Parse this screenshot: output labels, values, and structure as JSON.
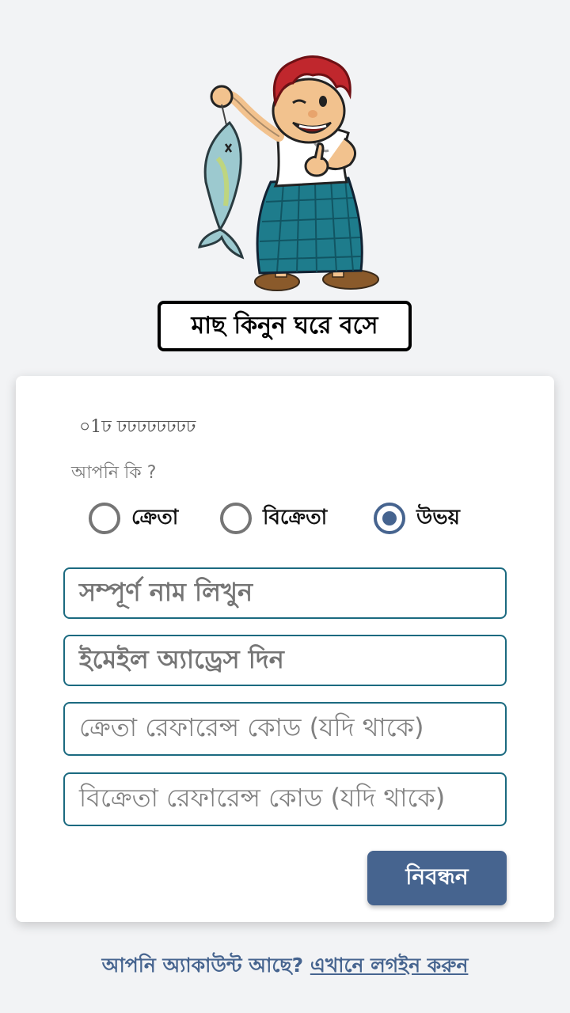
{
  "hero": {
    "icon": "fish-seller-mascot",
    "tagline": "মাছ কিনুন ঘরে বসে"
  },
  "form": {
    "phone": "০1ঢ ঢঢঢঢঢঢঢঢ",
    "role_question": "আপনি কি ?",
    "roles": [
      {
        "label": "ক্রেতা",
        "checked": false
      },
      {
        "label": "বিক্রেতা",
        "checked": false
      },
      {
        "label": "উভয়",
        "checked": true
      }
    ],
    "fields": {
      "full_name": "সম্পূর্ণ নাম লিখুন",
      "email": "ইমেইল অ্যাড্রেস দিন",
      "buyer_ref": "ক্রেতা রেফারেন্স কোড (যদি থাকে)",
      "seller_ref": "বিক্রেতা রেফারেন্স কোড (যদি থাকে)"
    },
    "submit_label": "নিবন্ধন"
  },
  "footer": {
    "prompt": "আপনি অ্যাকাউন্ট আছে?",
    "login_link": "এখানে লগইন করুন"
  },
  "colors": {
    "accent": "#46648f",
    "field_border": "#1b6a80",
    "background": "#f2f3f5"
  }
}
